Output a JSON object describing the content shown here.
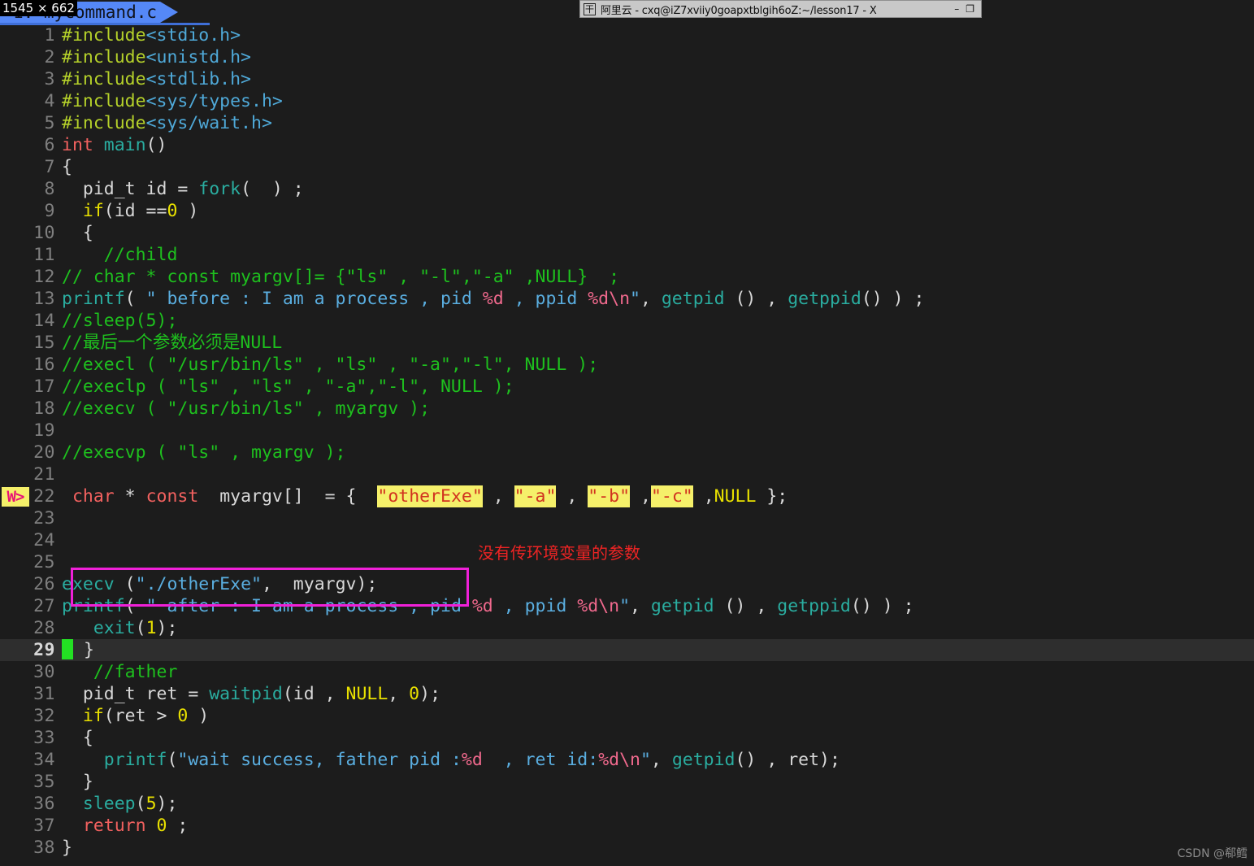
{
  "window": {
    "title_bar": {
      "logo_glyph": "干",
      "title": "阿里云 - cxq@iZ7xviiy0goapxtblgih6oZ:~/lesson17 - X",
      "minimize_label": "–",
      "restore_label": "❐"
    }
  },
  "size_badge": {
    "text": "1545 × 662"
  },
  "editor": {
    "tab": {
      "label": "1: mycommand.c"
    },
    "cursor_line": 29,
    "warning_marker": {
      "line": 22,
      "label": "W>"
    },
    "colors": {
      "background": "#1c1c1c",
      "current_line": "#2e2e2e",
      "gutter_text": "#7f7f7f",
      "preprocessor": "#b5d12a",
      "header": "#4fa9d8",
      "keyword": "#f2615f",
      "function": "#2aada0",
      "comment": "#1ec01e",
      "string": "#5aaee0",
      "format_spec": "#f0698d",
      "number": "#e8e000",
      "highlight_bg": "#f5f06a",
      "highlight_fg": "#d1331f",
      "cursor": "#23e023",
      "tab_bg": "#5588f7",
      "annotation": "#ef2424",
      "annotation_box": "#f020d8"
    },
    "lines": [
      {
        "n": 1,
        "tokens": [
          {
            "t": "#include",
            "c": "c-pre"
          },
          {
            "t": "<stdio.h>",
            "c": "c-hdr"
          }
        ]
      },
      {
        "n": 2,
        "tokens": [
          {
            "t": "#include",
            "c": "c-pre"
          },
          {
            "t": "<unistd.h>",
            "c": "c-hdr"
          }
        ]
      },
      {
        "n": 3,
        "tokens": [
          {
            "t": "#include",
            "c": "c-pre"
          },
          {
            "t": "<stdlib.h>",
            "c": "c-hdr"
          }
        ]
      },
      {
        "n": 4,
        "tokens": [
          {
            "t": "#include",
            "c": "c-pre"
          },
          {
            "t": "<sys/types.h>",
            "c": "c-hdr"
          }
        ]
      },
      {
        "n": 5,
        "tokens": [
          {
            "t": "#include",
            "c": "c-pre"
          },
          {
            "t": "<sys/wait.h>",
            "c": "c-hdr"
          }
        ]
      },
      {
        "n": 6,
        "tokens": [
          {
            "t": "int ",
            "c": "c-kw"
          },
          {
            "t": "main",
            "c": "c-fn"
          },
          {
            "t": "()",
            "c": "c-plain"
          }
        ]
      },
      {
        "n": 7,
        "tokens": [
          {
            "t": "{",
            "c": "c-plain"
          }
        ]
      },
      {
        "n": 8,
        "tokens": [
          {
            "t": "  pid_t id = ",
            "c": "c-plain"
          },
          {
            "t": "fork",
            "c": "c-fn"
          },
          {
            "t": "(  ) ;",
            "c": "c-plain"
          }
        ]
      },
      {
        "n": 9,
        "tokens": [
          {
            "t": "  ",
            "c": "c-plain"
          },
          {
            "t": "if",
            "c": "c-cond"
          },
          {
            "t": "(id ==",
            "c": "c-plain"
          },
          {
            "t": "0",
            "c": "c-num"
          },
          {
            "t": " )",
            "c": "c-plain"
          }
        ]
      },
      {
        "n": 10,
        "tokens": [
          {
            "t": "  {",
            "c": "c-plain"
          }
        ]
      },
      {
        "n": 11,
        "tokens": [
          {
            "t": "    //child",
            "c": "c-cmt"
          }
        ]
      },
      {
        "n": 12,
        "tokens": [
          {
            "t": "// char * const myargv[]= {\"ls\" , \"-l\",\"-a\" ,NULL}  ;",
            "c": "c-cmt"
          }
        ]
      },
      {
        "n": 13,
        "tokens": [
          {
            "t": "printf",
            "c": "c-fn"
          },
          {
            "t": "( ",
            "c": "c-plain"
          },
          {
            "t": "\" before : I am a process , pid ",
            "c": "c-str"
          },
          {
            "t": "%d",
            "c": "c-fmt"
          },
          {
            "t": " , ppid ",
            "c": "c-str"
          },
          {
            "t": "%d\\n",
            "c": "c-fmt"
          },
          {
            "t": "\"",
            "c": "c-str"
          },
          {
            "t": ", ",
            "c": "c-plain"
          },
          {
            "t": "getpid",
            "c": "c-fn"
          },
          {
            "t": " () , ",
            "c": "c-plain"
          },
          {
            "t": "getppid",
            "c": "c-fn"
          },
          {
            "t": "() ) ;",
            "c": "c-plain"
          }
        ]
      },
      {
        "n": 14,
        "tokens": [
          {
            "t": "//sleep(5);",
            "c": "c-cmt"
          }
        ]
      },
      {
        "n": 15,
        "tokens": [
          {
            "t": "//最后一个参数必须是NULL",
            "c": "c-cmt"
          }
        ]
      },
      {
        "n": 16,
        "tokens": [
          {
            "t": "//execl ( \"/usr/bin/ls\" , \"ls\" , \"-a\",\"-l\", NULL );",
            "c": "c-cmt"
          }
        ]
      },
      {
        "n": 17,
        "tokens": [
          {
            "t": "//execlp ( \"ls\" , \"ls\" , \"-a\",\"-l\", NULL );",
            "c": "c-cmt"
          }
        ]
      },
      {
        "n": 18,
        "tokens": [
          {
            "t": "//execv ( \"/usr/bin/ls\" , myargv );",
            "c": "c-cmt"
          }
        ]
      },
      {
        "n": 19,
        "tokens": [
          {
            "t": "",
            "c": "c-plain"
          }
        ]
      },
      {
        "n": 20,
        "tokens": [
          {
            "t": "//execvp ( \"ls\" , myargv );",
            "c": "c-cmt"
          }
        ]
      },
      {
        "n": 21,
        "tokens": [
          {
            "t": "",
            "c": "c-plain"
          }
        ]
      },
      {
        "n": 22,
        "tokens": [
          {
            "t": " ",
            "c": "c-plain"
          },
          {
            "t": "char",
            "c": "c-kw"
          },
          {
            "t": " * ",
            "c": "c-plain"
          },
          {
            "t": "const",
            "c": "c-kw"
          },
          {
            "t": "  myargv[]  = {  ",
            "c": "c-plain"
          },
          {
            "t": "\"otherExe\"",
            "c": "hl"
          },
          {
            "t": " , ",
            "c": "c-plain"
          },
          {
            "t": "\"-a\"",
            "c": "hl"
          },
          {
            "t": " , ",
            "c": "c-plain"
          },
          {
            "t": "\"-b\"",
            "c": "hl"
          },
          {
            "t": " ,",
            "c": "c-plain"
          },
          {
            "t": "\"-c\"",
            "c": "hl"
          },
          {
            "t": " ,",
            "c": "c-plain"
          },
          {
            "t": "NULL",
            "c": "c-null"
          },
          {
            "t": " };",
            "c": "c-plain"
          }
        ]
      },
      {
        "n": 23,
        "tokens": [
          {
            "t": "",
            "c": "c-plain"
          }
        ]
      },
      {
        "n": 24,
        "tokens": [
          {
            "t": "",
            "c": "c-plain"
          }
        ]
      },
      {
        "n": 25,
        "tokens": [
          {
            "t": "",
            "c": "c-plain"
          }
        ]
      },
      {
        "n": 26,
        "tokens": [
          {
            "t": "execv",
            "c": "c-fn"
          },
          {
            "t": " (",
            "c": "c-plain"
          },
          {
            "t": "\"./otherExe\"",
            "c": "c-str"
          },
          {
            "t": ",  myargv);",
            "c": "c-plain"
          }
        ]
      },
      {
        "n": 27,
        "tokens": [
          {
            "t": "printf",
            "c": "c-fn"
          },
          {
            "t": "( ",
            "c": "c-plain"
          },
          {
            "t": "\" after : I am a process , pid ",
            "c": "c-str"
          },
          {
            "t": "%d",
            "c": "c-fmt"
          },
          {
            "t": " , ppid ",
            "c": "c-str"
          },
          {
            "t": "%d\\n",
            "c": "c-fmt"
          },
          {
            "t": "\"",
            "c": "c-str"
          },
          {
            "t": ", ",
            "c": "c-plain"
          },
          {
            "t": "getpid",
            "c": "c-fn"
          },
          {
            "t": " () , ",
            "c": "c-plain"
          },
          {
            "t": "getppid",
            "c": "c-fn"
          },
          {
            "t": "() ) ;",
            "c": "c-plain"
          }
        ]
      },
      {
        "n": 28,
        "tokens": [
          {
            "t": "   ",
            "c": "c-plain"
          },
          {
            "t": "exit",
            "c": "c-fn"
          },
          {
            "t": "(",
            "c": "c-plain"
          },
          {
            "t": "1",
            "c": "c-num"
          },
          {
            "t": ");",
            "c": "c-plain"
          }
        ]
      },
      {
        "n": 29,
        "tokens": [
          {
            "t": "CURSOR",
            "c": "cursor"
          },
          {
            "t": "}",
            "c": "c-plain"
          }
        ]
      },
      {
        "n": 30,
        "tokens": [
          {
            "t": "   //father",
            "c": "c-cmt"
          }
        ]
      },
      {
        "n": 31,
        "tokens": [
          {
            "t": "  pid_t ret = ",
            "c": "c-plain"
          },
          {
            "t": "waitpid",
            "c": "c-fn"
          },
          {
            "t": "(id , ",
            "c": "c-plain"
          },
          {
            "t": "NULL",
            "c": "c-null"
          },
          {
            "t": ", ",
            "c": "c-plain"
          },
          {
            "t": "0",
            "c": "c-num"
          },
          {
            "t": ");",
            "c": "c-plain"
          }
        ]
      },
      {
        "n": 32,
        "tokens": [
          {
            "t": "  ",
            "c": "c-plain"
          },
          {
            "t": "if",
            "c": "c-cond"
          },
          {
            "t": "(ret > ",
            "c": "c-plain"
          },
          {
            "t": "0",
            "c": "c-num"
          },
          {
            "t": " )",
            "c": "c-plain"
          }
        ]
      },
      {
        "n": 33,
        "tokens": [
          {
            "t": "  {",
            "c": "c-plain"
          }
        ]
      },
      {
        "n": 34,
        "tokens": [
          {
            "t": "    ",
            "c": "c-plain"
          },
          {
            "t": "printf",
            "c": "c-fn"
          },
          {
            "t": "(",
            "c": "c-plain"
          },
          {
            "t": "\"wait success, father pid :",
            "c": "c-str"
          },
          {
            "t": "%d",
            "c": "c-fmt"
          },
          {
            "t": "  , ret id:",
            "c": "c-str"
          },
          {
            "t": "%d\\n",
            "c": "c-fmt"
          },
          {
            "t": "\"",
            "c": "c-str"
          },
          {
            "t": ", ",
            "c": "c-plain"
          },
          {
            "t": "getpid",
            "c": "c-fn"
          },
          {
            "t": "() , ret);",
            "c": "c-plain"
          }
        ]
      },
      {
        "n": 35,
        "tokens": [
          {
            "t": "  }",
            "c": "c-plain"
          }
        ]
      },
      {
        "n": 36,
        "tokens": [
          {
            "t": "  ",
            "c": "c-plain"
          },
          {
            "t": "sleep",
            "c": "c-fn"
          },
          {
            "t": "(",
            "c": "c-plain"
          },
          {
            "t": "5",
            "c": "c-num"
          },
          {
            "t": ");",
            "c": "c-plain"
          }
        ]
      },
      {
        "n": 37,
        "tokens": [
          {
            "t": "  ",
            "c": "c-plain"
          },
          {
            "t": "return",
            "c": "c-kw"
          },
          {
            "t": " ",
            "c": "c-plain"
          },
          {
            "t": "0",
            "c": "c-num"
          },
          {
            "t": " ;",
            "c": "c-plain"
          }
        ]
      },
      {
        "n": 38,
        "tokens": [
          {
            "t": "}",
            "c": "c-plain"
          }
        ]
      }
    ]
  },
  "annotations": {
    "note_text": "没有传环境变量的参数",
    "box_target_line": 26
  },
  "watermark": {
    "text": "CSDN @郗鳕"
  }
}
